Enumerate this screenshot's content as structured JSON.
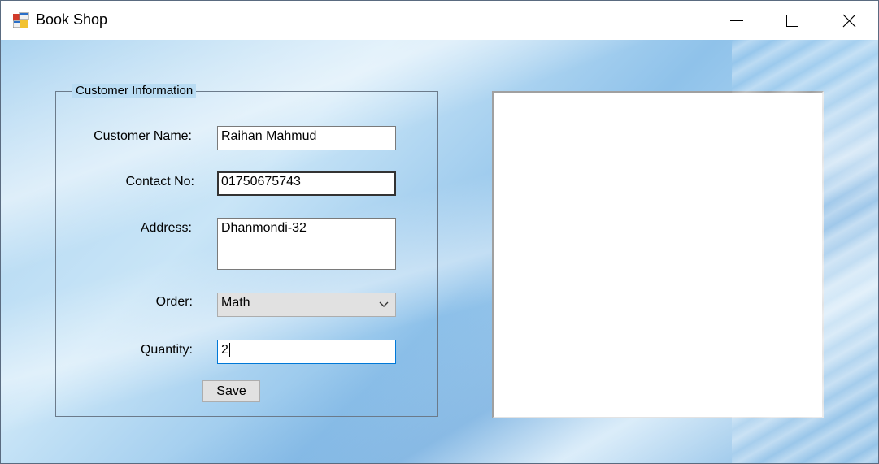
{
  "window": {
    "title": "Book Shop"
  },
  "customer_info": {
    "group_title": "Customer Information",
    "name_label": "Customer Name:",
    "name_value": "Raihan Mahmud",
    "contact_label": "Contact No:",
    "contact_value": "01750675743",
    "address_label": "Address:",
    "address_value": "Dhanmondi-32",
    "order_label": "Order:",
    "order_value": "Math",
    "quantity_label": "Quantity:",
    "quantity_value": "2",
    "save_label": "Save"
  },
  "icons": {
    "app": "app-form-icon",
    "minimize": "minimize-icon",
    "maximize": "maximize-icon",
    "close": "close-icon",
    "dropdown": "chevron-down-icon"
  },
  "colors": {
    "focus_border": "#0078d7",
    "background_accent": "#a8d2f0"
  }
}
